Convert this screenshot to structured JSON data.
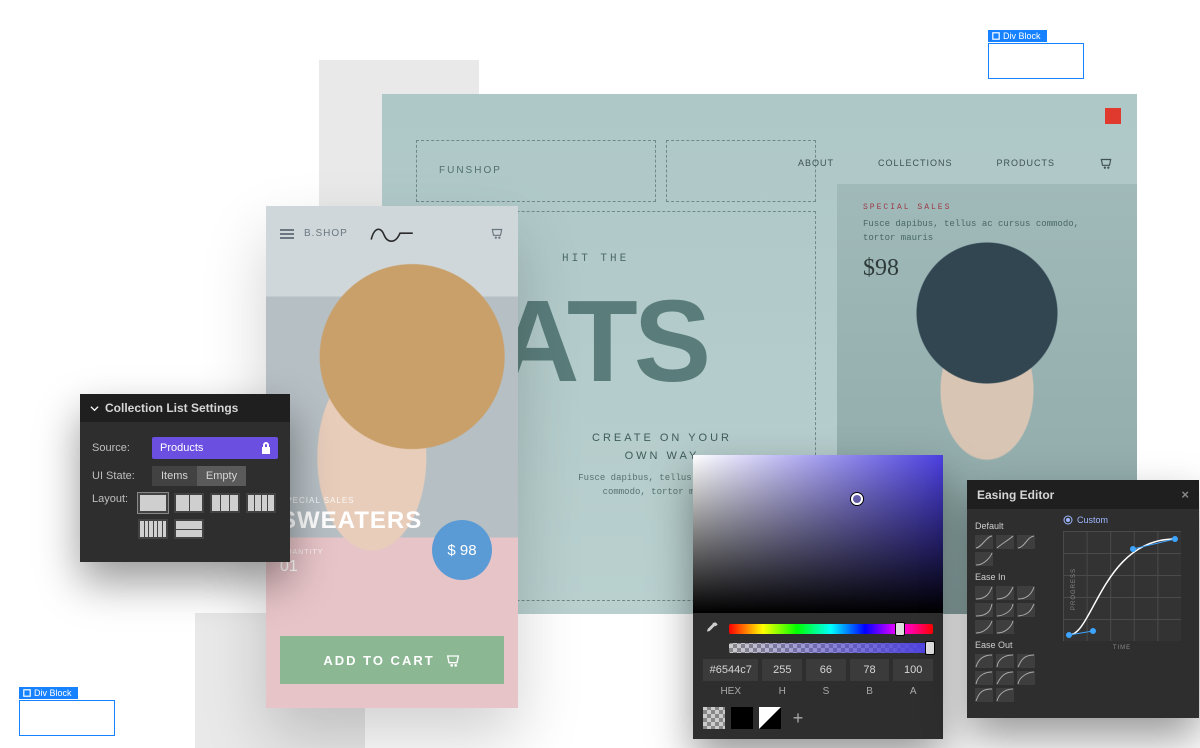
{
  "div_block_label": "Div Block",
  "desktop": {
    "logo": "FUNSHOP",
    "nav": {
      "about": "ABOUT",
      "collections": "COLLECTIONS",
      "products": "PRODUCTS"
    },
    "hero": {
      "overline": "HIT THE",
      "headline": "HATS",
      "sub_l1": "CREATE ON YOUR",
      "sub_l2": "OWN WAY",
      "lorem": "Fusce dapibus, tellus ac cursus commodo, tortor mauris"
    },
    "promo": {
      "tag": "SPECIAL SALES",
      "copy": "Fusce dapibus, tellus ac cursus commodo, tortor mauris",
      "price": "$98"
    }
  },
  "mobile": {
    "brand": "B.SHOP",
    "section": {
      "overline": "SPECIAL SALES",
      "title": "SWEATERS",
      "qty_label": "QUANTITY",
      "qty": "01"
    },
    "price": "$ 98",
    "cta": "ADD TO CART"
  },
  "cls": {
    "title": "Collection List Settings",
    "source_label": "Source:",
    "source_value": "Products",
    "ui_state_label": "UI State:",
    "opt_items": "Items",
    "opt_empty": "Empty",
    "layout_label": "Layout:"
  },
  "colorpicker": {
    "hex_value": "#6544c7",
    "h": "255",
    "s": "66",
    "b": "78",
    "a": "100",
    "hex_label": "HEX",
    "h_label": "H",
    "s_label": "S",
    "b_label": "B",
    "a_label": "A"
  },
  "easing": {
    "title": "Easing Editor",
    "default": "Default",
    "ease_in": "Ease In",
    "ease_out": "Ease Out",
    "custom": "Custom",
    "axis_y": "PROGRESS",
    "axis_x": "TIME"
  }
}
